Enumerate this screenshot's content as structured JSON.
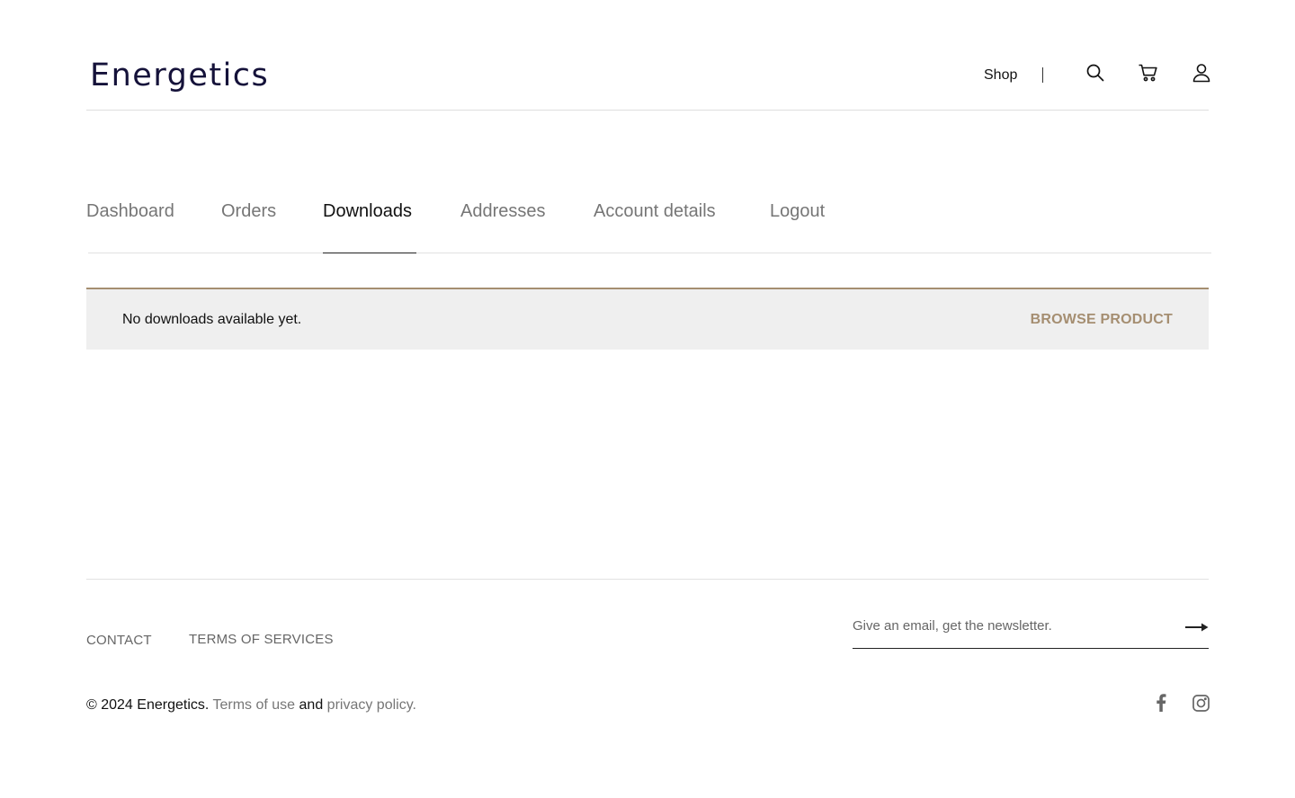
{
  "header": {
    "logo": "Energetics",
    "nav": {
      "shop": "Shop"
    },
    "icons": [
      "search-icon",
      "cart-icon",
      "user-icon"
    ]
  },
  "account_tabs": [
    {
      "label": "Dashboard",
      "active": false
    },
    {
      "label": "Orders",
      "active": false
    },
    {
      "label": "Downloads",
      "active": true
    },
    {
      "label": "Addresses",
      "active": false
    },
    {
      "label": "Account details",
      "active": false
    },
    {
      "label": "Logout",
      "active": false
    }
  ],
  "notice": {
    "message": "No downloads available yet.",
    "action_label": "BROWSE PRODUCT"
  },
  "footer": {
    "links": [
      "CONTACT",
      "TERMS OF SERVICES"
    ],
    "newsletter_placeholder": "Give an email, get the newsletter.",
    "copyright_prefix": "© 2024 Energetics.",
    "terms_link": "Terms of use",
    "joiner": "and",
    "privacy_link": "privacy policy.",
    "social": [
      "facebook-icon",
      "instagram-icon"
    ]
  },
  "colors": {
    "accent": "#a58e71",
    "logo": "#15123a",
    "notice_bg": "#efefef",
    "muted_text": "#767676"
  }
}
